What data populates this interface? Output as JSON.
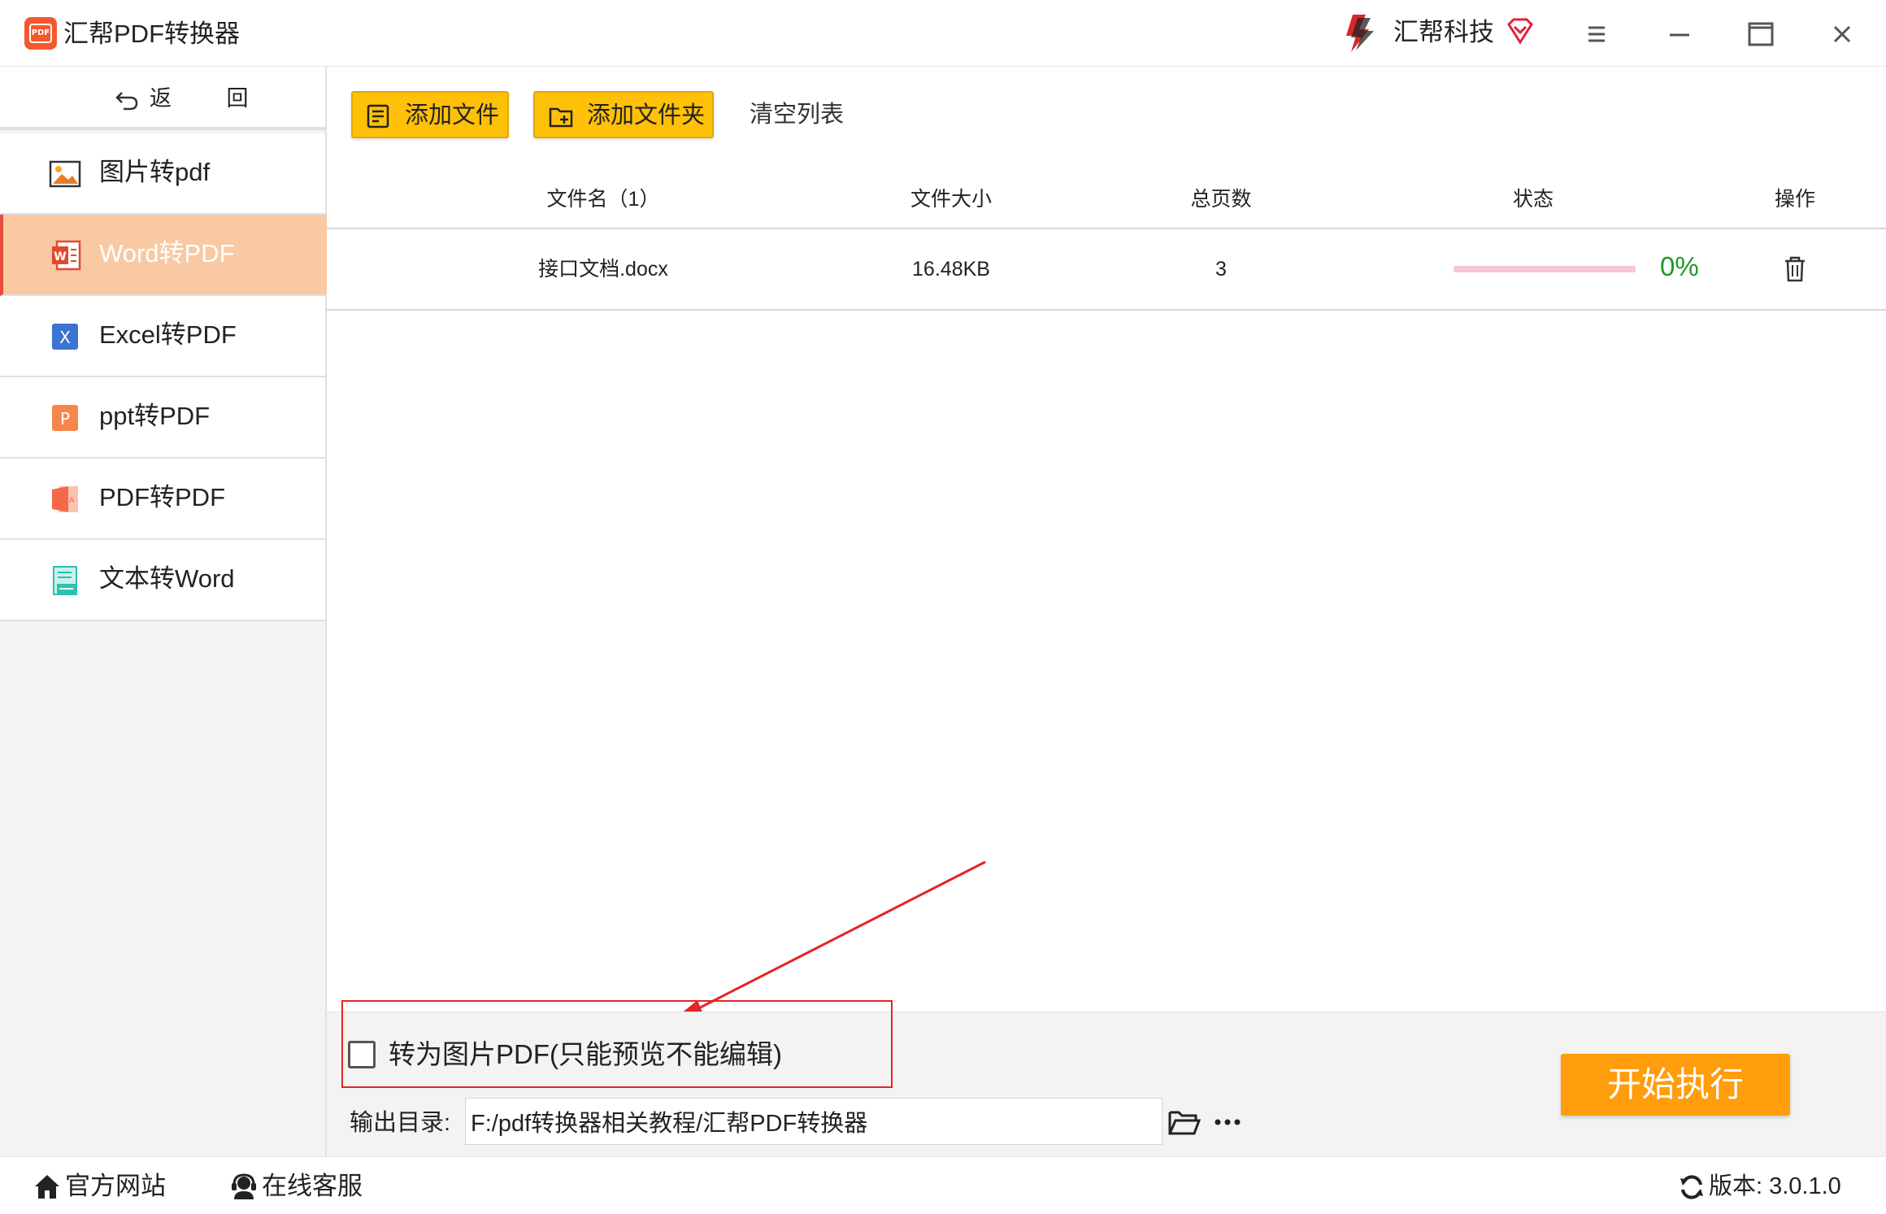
{
  "app": {
    "title": "汇帮PDF转换器",
    "brand": "汇帮科技"
  },
  "window_controls": [
    "menu-icon",
    "minimize-icon",
    "maximize-icon",
    "close-icon"
  ],
  "sidebar": {
    "back_label": "返 回",
    "items": [
      {
        "label": "图片转pdf",
        "icon": "image-icon",
        "active": false
      },
      {
        "label": "Word转PDF",
        "icon": "word-icon",
        "active": true
      },
      {
        "label": "Excel转PDF",
        "icon": "excel-icon",
        "active": false
      },
      {
        "label": "ppt转PDF",
        "icon": "ppt-icon",
        "active": false
      },
      {
        "label": "PDF转PDF",
        "icon": "pdf-icon",
        "active": false
      },
      {
        "label": "文本转Word",
        "icon": "text-icon",
        "active": false
      }
    ]
  },
  "toolbar": {
    "add_file": "添加文件",
    "add_folder": "添加文件夹",
    "clear_list": "清空列表"
  },
  "table": {
    "headers": {
      "name": "文件名（1）",
      "size": "文件大小",
      "pages": "总页数",
      "status": "状态",
      "action": "操作"
    },
    "rows": [
      {
        "name": "接口文档.docx",
        "size": "16.48KB",
        "pages": "3",
        "progress": 0,
        "percent": "0%"
      }
    ]
  },
  "options": {
    "to_image_pdf_label": "转为图片PDF(只能预览不能编辑)",
    "to_image_pdf_checked": false
  },
  "output": {
    "label": "输出目录:",
    "path": "F:/pdf转换器相关教程/汇帮PDF转换器"
  },
  "start_button": "开始执行",
  "statusbar": {
    "website": "官方网站",
    "support": "在线客服",
    "version": "版本:  3.0.1.0"
  },
  "colors": {
    "accent_yellow": "#ffc107",
    "start_orange": "#ff9d0d",
    "active_item_bg": "#f8c9a3",
    "progress_track": "#f6c7d3",
    "percent_green": "#1a9b26",
    "annotation_red": "#e32525"
  }
}
